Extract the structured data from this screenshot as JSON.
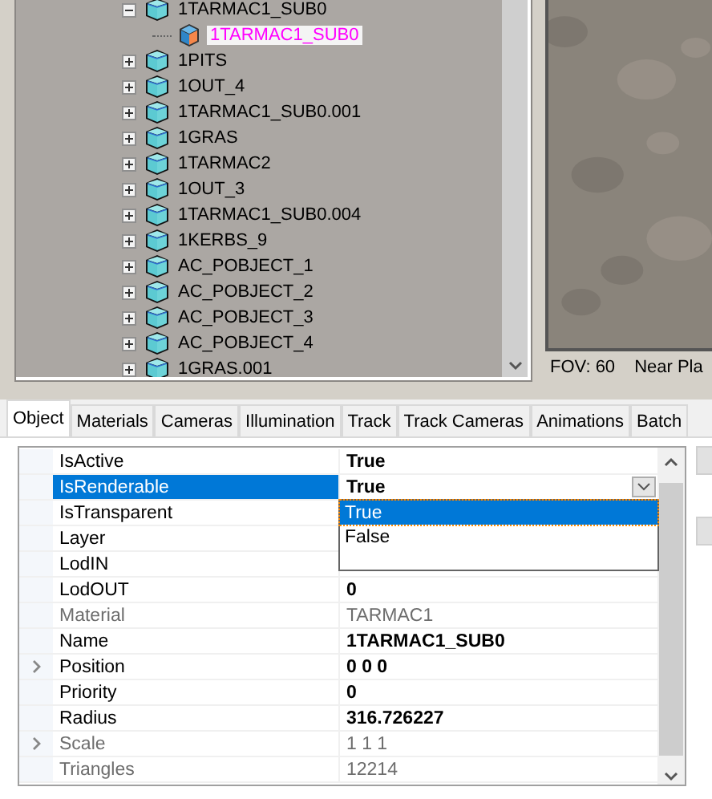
{
  "tree": [
    {
      "label": "1TARMAC1_SUB0",
      "kind": "mesh",
      "expanded": true,
      "selected": false,
      "children": [
        {
          "label": "1TARMAC1_SUB0",
          "kind": "submesh",
          "selected": true
        }
      ]
    },
    {
      "label": "1PITS",
      "kind": "mesh",
      "expanded": false,
      "selected": false
    },
    {
      "label": "1OUT_4",
      "kind": "mesh",
      "expanded": false,
      "selected": false
    },
    {
      "label": "1TARMAC1_SUB0.001",
      "kind": "mesh",
      "expanded": false,
      "selected": false
    },
    {
      "label": "1GRAS",
      "kind": "mesh",
      "expanded": false,
      "selected": false
    },
    {
      "label": "1TARMAC2",
      "kind": "mesh",
      "expanded": false,
      "selected": false
    },
    {
      "label": "1OUT_3",
      "kind": "mesh",
      "expanded": false,
      "selected": false
    },
    {
      "label": "1TARMAC1_SUB0.004",
      "kind": "mesh",
      "expanded": false,
      "selected": false
    },
    {
      "label": "1KERBS_9",
      "kind": "mesh",
      "expanded": false,
      "selected": false
    },
    {
      "label": "AC_POBJECT_1",
      "kind": "mesh",
      "expanded": false,
      "selected": false
    },
    {
      "label": "AC_POBJECT_2",
      "kind": "mesh",
      "expanded": false,
      "selected": false
    },
    {
      "label": "AC_POBJECT_3",
      "kind": "mesh",
      "expanded": false,
      "selected": false
    },
    {
      "label": "AC_POBJECT_4",
      "kind": "mesh",
      "expanded": false,
      "selected": false
    },
    {
      "label": "1GRAS.001",
      "kind": "mesh",
      "expanded": false,
      "selected": false
    }
  ],
  "viewport": {
    "kind": "picture",
    "fov": "FOV: 60",
    "near_plane": "Near Pla"
  },
  "tabs": [
    {
      "label": "Object",
      "selected": true
    },
    {
      "label": "Materials",
      "selected": false
    },
    {
      "label": "Cameras",
      "selected": false
    },
    {
      "label": "Illumination",
      "selected": false
    },
    {
      "label": "Track",
      "selected": false
    },
    {
      "label": "Track Cameras",
      "selected": false
    },
    {
      "label": "Animations",
      "selected": false
    },
    {
      "label": "Batch",
      "selected": false
    }
  ],
  "properties": [
    {
      "name": "IsActive",
      "value": "True",
      "disabled": false,
      "selected": false,
      "expandable": false
    },
    {
      "name": "IsRenderable",
      "value": "True",
      "disabled": false,
      "selected": true,
      "expandable": false
    },
    {
      "name": "IsTransparent",
      "disabled": false,
      "selected": false,
      "expandable": false
    },
    {
      "name": "Layer",
      "disabled": false,
      "selected": false,
      "expandable": false
    },
    {
      "name": "LodIN",
      "disabled": false,
      "selected": false,
      "expandable": false
    },
    {
      "name": "LodOUT",
      "value": "0",
      "disabled": false,
      "selected": false,
      "expandable": false
    },
    {
      "name": "Material",
      "value": "TARMAC1",
      "disabled": true,
      "selected": false,
      "expandable": false
    },
    {
      "name": "Name",
      "value": "1TARMAC1_SUB0",
      "disabled": false,
      "selected": false,
      "expandable": false
    },
    {
      "name": "Position",
      "value": "0 0 0",
      "disabled": false,
      "selected": false,
      "expandable": true
    },
    {
      "name": "Priority",
      "value": "0",
      "disabled": false,
      "selected": false,
      "expandable": false
    },
    {
      "name": "Radius",
      "value": "316.726227",
      "disabled": false,
      "selected": false,
      "expandable": false
    },
    {
      "name": "Scale",
      "value": "1 1 1",
      "disabled": true,
      "selected": false,
      "expandable": true
    },
    {
      "name": "Triangles",
      "value": "12214",
      "disabled": true,
      "selected": false,
      "expandable": false
    }
  ],
  "dropdown": {
    "open": true,
    "options": [
      {
        "label": "True",
        "selected": true
      },
      {
        "label": "False",
        "selected": false
      }
    ]
  }
}
